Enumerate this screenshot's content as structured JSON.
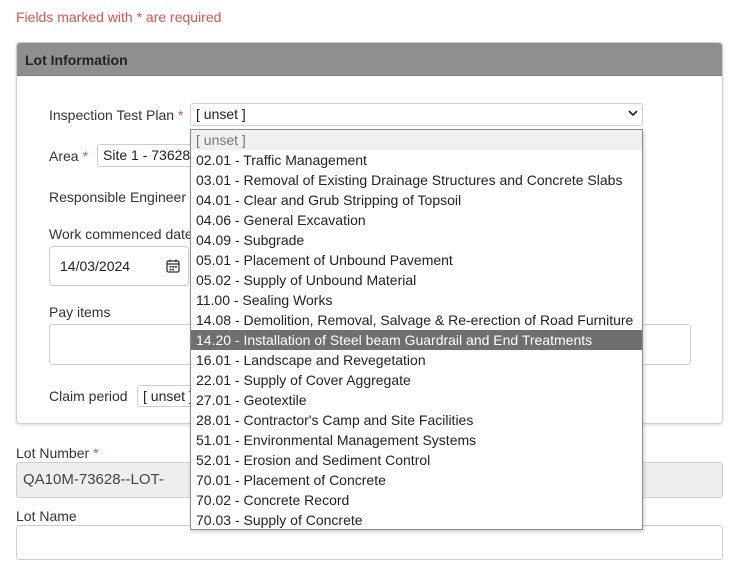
{
  "form": {
    "required_note": "Fields marked with * are required",
    "required_star": "*"
  },
  "panel": {
    "title": "Lot Information",
    "itp": {
      "label": "Inspection Test Plan",
      "value": "[ unset ]"
    },
    "area": {
      "label": "Area",
      "value": "Site 1 - 73628"
    },
    "engineer": {
      "label": "Responsible Engineer"
    },
    "work_commenced": {
      "label": "Work commenced date",
      "value": "14/03/2024"
    },
    "pay_items": {
      "label": "Pay items"
    },
    "claim_period": {
      "label": "Claim period",
      "value": "[ unset ]"
    }
  },
  "lot_number": {
    "label": "Lot Number",
    "value": "QA10M-73628--LOT-"
  },
  "lot_name": {
    "label": "Lot Name",
    "value": ""
  },
  "dropdown": {
    "options": [
      "[ unset ]",
      "02.01 - Traffic Management",
      "03.01 - Removal of Existing Drainage Structures and Concrete Slabs",
      "04.01 - Clear and Grub Stripping of Topsoil",
      "04.06 - General Excavation",
      "04.09 - Subgrade",
      "05.01 - Placement of Unbound Pavement",
      "05.02 - Supply of Unbound Material",
      "11.00 - Sealing Works",
      "14.08 - Demolition, Removal, Salvage & Re-erection of Road Furniture",
      "14.20 - Installation of Steel beam Guardrail and End Treatments",
      "16.01 - Landscape and Revegetation",
      "22.01 - Supply of Cover Aggregate",
      "27.01 - Geotextile",
      "28.01 - Contractor's Camp and Site Facilities",
      "51.01 - Environmental Management Systems",
      "52.01 - Erosion and Sediment Control",
      "70.01 - Placement of Concrete",
      "70.02 - Concrete Record",
      "70.03 - Supply of Concrete"
    ],
    "highlighted_index": 10
  }
}
